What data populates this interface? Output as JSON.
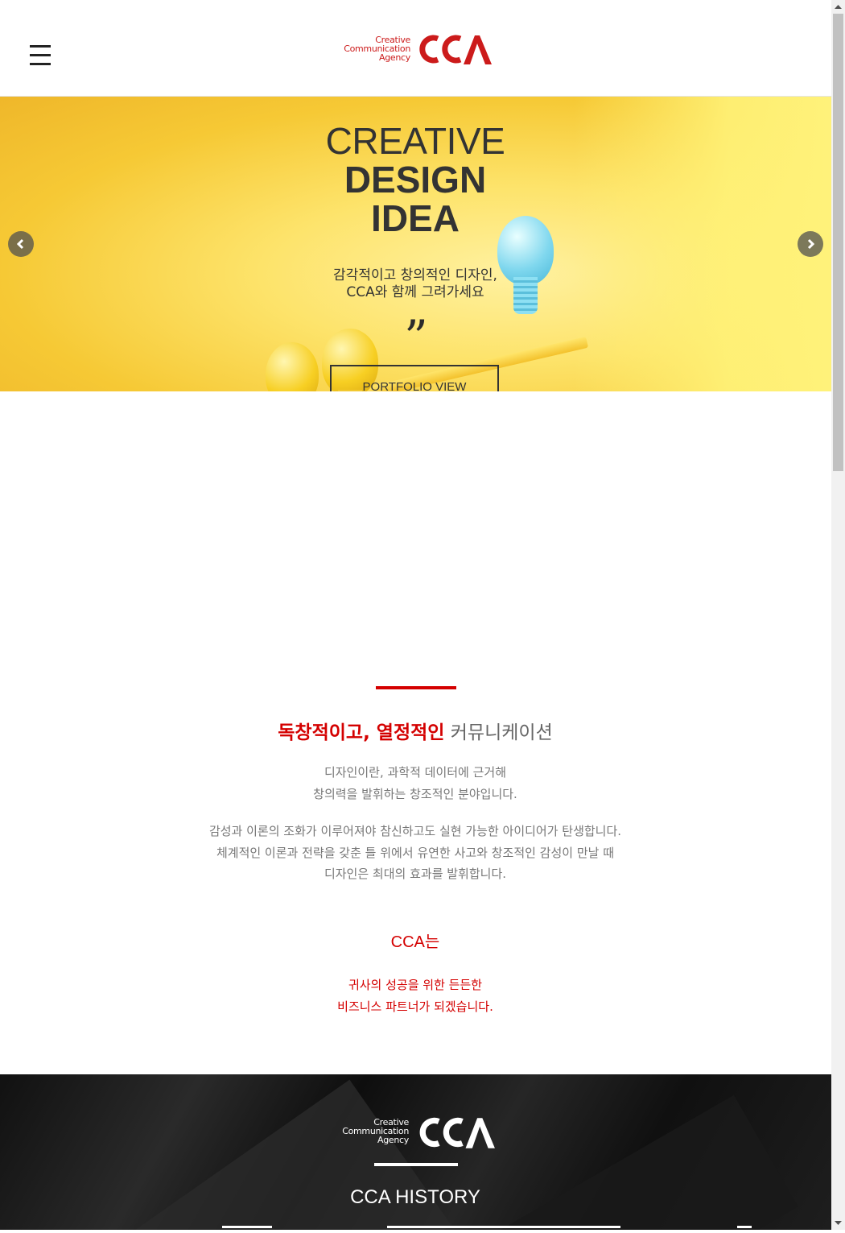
{
  "header": {
    "logo_words": [
      "Creative",
      "Communication",
      "Agency"
    ],
    "logo_mark": "CCA",
    "brand_color": "#cc1b1b"
  },
  "hero": {
    "line1": "CREATIVE",
    "line2": "DESIGN",
    "line3": "IDEA",
    "subtitle_line1": "감각적이고 창의적인 디자인,",
    "subtitle_line2": "CCA와 함께 그려가세요",
    "button_label": "PORTFOLIO VIEW",
    "background_color": "#fde36a"
  },
  "intro": {
    "title_em": "독창적이고, 열정적인",
    "title_rest": " 커뮤니케이션",
    "p1_line1": "디자인이란, 과학적 데이터에 근거해",
    "p1_line2": "창의력을 발휘하는 창조적인 분야입니다.",
    "p2_line1": "감성과 이론의 조화가 이루어져야 참신하고도 실현 가능한 아이디어가 탄생합니다.",
    "p2_line2": "체계적인 이론과 전략을 갖춘 틀 위에서 유연한 사고와 창조적인 감성이 만날 때",
    "p2_line3": "디자인은 최대의 효과를 발휘합니다.",
    "cca_is": "CCA는",
    "partner_line1": "귀사의 성공을 위한 든든한",
    "partner_line2": "비즈니스 파트너가 되겠습니다.",
    "accent_color": "#d40000"
  },
  "history": {
    "logo_words": [
      "Creative",
      "Communication",
      "Agency"
    ],
    "logo_mark": "CCA",
    "title": "CCA HISTORY"
  },
  "icons": {
    "menu": "hamburger-icon",
    "prev": "chevron-left-icon",
    "next": "chevron-right-icon"
  }
}
